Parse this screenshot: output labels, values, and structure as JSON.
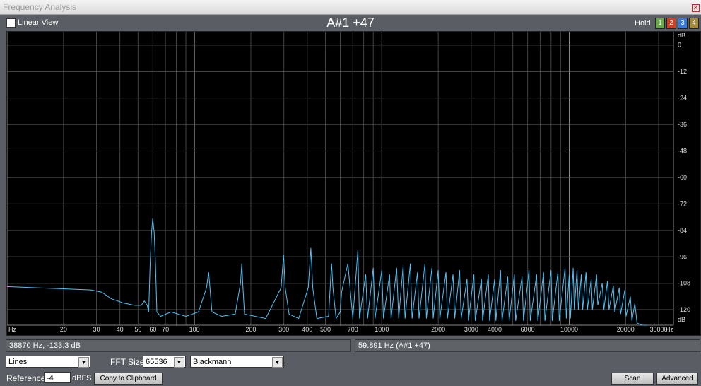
{
  "window": {
    "title": "Frequency Analysis",
    "close_glyph": "✕"
  },
  "toolbar": {
    "linear_view_label": "Linear View",
    "note_display": "A#1 +47",
    "hold_label": "Hold",
    "hold_buttons": [
      {
        "label": "1",
        "color": "#6aa84f"
      },
      {
        "label": "2",
        "color": "#cc4125"
      },
      {
        "label": "3",
        "color": "#3c78d8"
      },
      {
        "label": "4",
        "color": "#a38a3a"
      }
    ]
  },
  "chart_data": {
    "type": "line",
    "x_scale": "log",
    "xlabel": "Hz",
    "ylabel": "dB",
    "xlim": [
      10,
      36000
    ],
    "ylim": [
      -127,
      6
    ],
    "x_ticks": [
      {
        "v": 20,
        "t": "20"
      },
      {
        "v": 30,
        "t": "30"
      },
      {
        "v": 40,
        "t": "40"
      },
      {
        "v": 50,
        "t": "50"
      },
      {
        "v": 60,
        "t": "60"
      },
      {
        "v": 70,
        "t": "70"
      },
      {
        "v": 100,
        "t": "100"
      },
      {
        "v": 200,
        "t": "200"
      },
      {
        "v": 300,
        "t": "300"
      },
      {
        "v": 400,
        "t": "400"
      },
      {
        "v": 500,
        "t": "500"
      },
      {
        "v": 700,
        "t": "700"
      },
      {
        "v": 1000,
        "t": "1000"
      },
      {
        "v": 2000,
        "t": "2000"
      },
      {
        "v": 3000,
        "t": "3000"
      },
      {
        "v": 4000,
        "t": "4000"
      },
      {
        "v": 6000,
        "t": "6000"
      },
      {
        "v": 10000,
        "t": "10000"
      },
      {
        "v": 20000,
        "t": "20000"
      },
      {
        "v": 30000,
        "t": "30000"
      }
    ],
    "y_ticks": [
      0,
      -12,
      -24,
      -36,
      -48,
      -60,
      -72,
      -84,
      -96,
      -108,
      -120
    ],
    "series": [
      {
        "color": "#4fc3f7",
        "points": [
          [
            10,
            -109.5
          ],
          [
            14,
            -110
          ],
          [
            20,
            -110.5
          ],
          [
            28,
            -111
          ],
          [
            32,
            -112
          ],
          [
            36,
            -115
          ],
          [
            42,
            -117
          ],
          [
            48,
            -118
          ],
          [
            52,
            -118
          ],
          [
            54,
            -116
          ],
          [
            56,
            -118
          ],
          [
            57,
            -121
          ],
          [
            58,
            -100
          ],
          [
            59,
            -85
          ],
          [
            59.891,
            -78.6
          ],
          [
            61,
            -85
          ],
          [
            62,
            -100
          ],
          [
            63,
            -121
          ],
          [
            66,
            -123
          ],
          [
            75,
            -121
          ],
          [
            90,
            -123
          ],
          [
            105,
            -121
          ],
          [
            116,
            -110
          ],
          [
            119,
            -103
          ],
          [
            121,
            -110
          ],
          [
            124,
            -121
          ],
          [
            140,
            -123
          ],
          [
            165,
            -122
          ],
          [
            176,
            -108
          ],
          [
            179,
            -99
          ],
          [
            181,
            -108
          ],
          [
            185,
            -122
          ],
          [
            240,
            -124
          ],
          [
            290,
            -110
          ],
          [
            299,
            -95
          ],
          [
            305,
            -110
          ],
          [
            320,
            -122
          ],
          [
            360,
            -124
          ],
          [
            405,
            -110
          ],
          [
            418,
            -92
          ],
          [
            428,
            -110
          ],
          [
            450,
            -124
          ],
          [
            520,
            -123
          ],
          [
            530,
            -110
          ],
          [
            539,
            -99
          ],
          [
            548,
            -110
          ],
          [
            570,
            -124
          ],
          [
            600,
            -121
          ],
          [
            610,
            -112
          ],
          [
            659,
            -99
          ],
          [
            680,
            -112
          ],
          [
            700,
            -124
          ],
          [
            745,
            -93
          ],
          [
            760,
            -124
          ],
          [
            820,
            -104
          ],
          [
            840,
            -124
          ],
          [
            900,
            -101
          ],
          [
            920,
            -124
          ],
          [
            1000,
            -102
          ],
          [
            1020,
            -124
          ],
          [
            1100,
            -104
          ],
          [
            1120,
            -124
          ],
          [
            1200,
            -101
          ],
          [
            1230,
            -124
          ],
          [
            1300,
            -100
          ],
          [
            1330,
            -124
          ],
          [
            1420,
            -99
          ],
          [
            1450,
            -124
          ],
          [
            1550,
            -103
          ],
          [
            1580,
            -124
          ],
          [
            1700,
            -99
          ],
          [
            1730,
            -124
          ],
          [
            1850,
            -101
          ],
          [
            1880,
            -124
          ],
          [
            2000,
            -102
          ],
          [
            2040,
            -124
          ],
          [
            2200,
            -103
          ],
          [
            2240,
            -124
          ],
          [
            2400,
            -104
          ],
          [
            2450,
            -124
          ],
          [
            2600,
            -102
          ],
          [
            2650,
            -124
          ],
          [
            2850,
            -106
          ],
          [
            2900,
            -125
          ],
          [
            3100,
            -104
          ],
          [
            3150,
            -125
          ],
          [
            3400,
            -106
          ],
          [
            3450,
            -125
          ],
          [
            3700,
            -104
          ],
          [
            3760,
            -125
          ],
          [
            4000,
            -106
          ],
          [
            4060,
            -125
          ],
          [
            4300,
            -102
          ],
          [
            4380,
            -125
          ],
          [
            4700,
            -105
          ],
          [
            4780,
            -125
          ],
          [
            5100,
            -104
          ],
          [
            5180,
            -125
          ],
          [
            5600,
            -105
          ],
          [
            5700,
            -125
          ],
          [
            6100,
            -102
          ],
          [
            6200,
            -125
          ],
          [
            6700,
            -104
          ],
          [
            6800,
            -125
          ],
          [
            7300,
            -103
          ],
          [
            7420,
            -125
          ],
          [
            8000,
            -102
          ],
          [
            8120,
            -125
          ],
          [
            8700,
            -103
          ],
          [
            8850,
            -125
          ],
          [
            9500,
            -101
          ],
          [
            9650,
            -124
          ],
          [
            10000,
            -104
          ],
          [
            10150,
            -124
          ],
          [
            10500,
            -101
          ],
          [
            10650,
            -120
          ],
          [
            11000,
            -102
          ],
          [
            11200,
            -120
          ],
          [
            11600,
            -104
          ],
          [
            11800,
            -120
          ],
          [
            12300,
            -103
          ],
          [
            12500,
            -120
          ],
          [
            13100,
            -106
          ],
          [
            13300,
            -120
          ],
          [
            14000,
            -104
          ],
          [
            14200,
            -118
          ],
          [
            15000,
            -108
          ],
          [
            15300,
            -120
          ],
          [
            16000,
            -107
          ],
          [
            16300,
            -120
          ],
          [
            17200,
            -109
          ],
          [
            17500,
            -121
          ],
          [
            18500,
            -110
          ],
          [
            18800,
            -122
          ],
          [
            19800,
            -111
          ],
          [
            20100,
            -123
          ],
          [
            21200,
            -114
          ],
          [
            21600,
            -125
          ],
          [
            22400,
            -117
          ],
          [
            23000,
            -126
          ],
          [
            24500,
            -127
          ],
          [
            26000,
            -127
          ]
        ]
      }
    ]
  },
  "status": {
    "cursor_readout": "38870 Hz, -133.3 dB",
    "peak_readout": "59.891 Hz (A#1 +47)"
  },
  "controls": {
    "display_mode": "Lines",
    "fft_size_label": "FFT Size",
    "fft_size": "65536",
    "window_function": "Blackmann",
    "reference_label": "Reference",
    "reference_value": "-4",
    "reference_unit": "dBFS",
    "copy_button": "Copy to Clipboard",
    "scan_button": "Scan",
    "advanced_button": "Advanced",
    "dropdown_glyph": "▼"
  }
}
